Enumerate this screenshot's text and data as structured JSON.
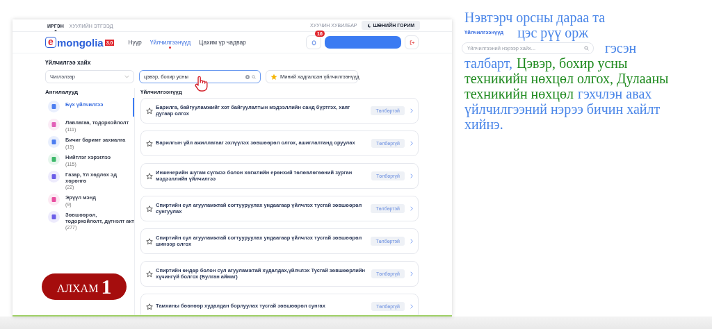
{
  "top_bar": {
    "tabs": [
      {
        "label": "ИРГЭН",
        "selected": true
      },
      {
        "label": "ХУУЛИЙН ЭТГЭЭД",
        "selected": false
      }
    ],
    "old_version_link": "ХУУЧИН ХУВИЛБАР",
    "night_mode_button": "ШӨНИЙН ГОРИМ"
  },
  "header": {
    "logo": {
      "letter": "e",
      "text": "mongolia",
      "version": "3.0"
    },
    "nav": [
      {
        "label": "Нүүр",
        "selected": false
      },
      {
        "label": "Үйлчилгээнүүд",
        "selected": true
      },
      {
        "label": "Цахим үр чадвар",
        "selected": false
      }
    ],
    "notifications": {
      "count": "16"
    }
  },
  "search": {
    "title": "Үйлчилгээ хайх",
    "category_select": {
      "value": "Чиглэлээр"
    },
    "search_field": {
      "value": "цэвэр, бохир усны"
    },
    "saved_button": "Миний хадгалсан үйлчилгээнүүд"
  },
  "categories": {
    "title": "Ангилалууд",
    "items": [
      {
        "name": "Бүх үйлчилгээ",
        "selected": true,
        "color": "#4c7df0"
      },
      {
        "name": "Лавлагаа, тодорхойлолт",
        "count": "(111)",
        "selected": false,
        "color": "#e25fb8"
      },
      {
        "name": "Бичиг баримт захиалга",
        "count": "(15)",
        "selected": false,
        "color": "#4c7df0"
      },
      {
        "name": "Нийтлэг хэрэглээ",
        "count": "(115)",
        "selected": false,
        "color": "#3db86a"
      },
      {
        "name": "Газар, Үл хөдлөх эд хөрөнгө",
        "count": "(22)",
        "selected": false,
        "color": "#6b5de8"
      },
      {
        "name": "Эрүүл мэнд",
        "count": "(9)",
        "selected": false,
        "color": "#e84fa0"
      },
      {
        "name": "Зөвшөөрөл, тодорхойлолт, дүгнэлт акт",
        "count": "(277)",
        "selected": false,
        "color": "#6b5de8"
      }
    ]
  },
  "services": {
    "title": "Үйлчилгээнүүд",
    "items": [
      {
        "title": "Барилга, байгууламжийг хот байгуулалтын мэдээллийн санд бүртгэх, хаяг дугаар олгох",
        "tag": "Төлбөртэй"
      },
      {
        "title": "Барилгын үйл ажиллагааг эхлүүлэх зөвшөөрөл олгох, ашиглалтанд оруулах",
        "tag": "Төлбөргүй"
      },
      {
        "title": "Инженерийн шугам сүлжээ болон хөгжлийн ерөнхий төлөвлөгөөний зурган мэдээллийн үйлчилгээ",
        "tag": "Төлбөргүй"
      },
      {
        "title": "Спиртийн сул агууламжтай согтууруулах ундаагаар үйлчлэх тусгай зөвшөөрөл сунгуулах",
        "tag": "Төлбөртэй"
      },
      {
        "title": "Спиртийн сул агууламжтай согтууруулах ундаагаар үйлчлэх тусгай зөвшөөрөл шинээр олгох",
        "tag": "Төлбөртэй"
      },
      {
        "title": "Спиртийн өндөр болон сул агууламжтай худалдах,үйлчлэх Тусгай зөвшөөрлийн хүчингүй болгох (Булган аймаг)",
        "tag": "Төлбөргүй"
      },
      {
        "title": "Тамхины бөөнөөр худалдан борлуулах тусгай зөвшөөрөл сунгах",
        "tag": "Төлбөргүй"
      }
    ]
  },
  "step": {
    "label": "АЛХАМ",
    "number": "1"
  },
  "instructions": [
    [
      {
        "kind": "text",
        "text": "Нэвтэрч орсны дараа та",
        "color": "#4a86e8"
      }
    ],
    [
      {
        "kind": "label",
        "text": "Үйлчилгээнүүд"
      },
      {
        "kind": "text",
        "text": "цэс рүү орж",
        "color": "#4a86e8"
      }
    ],
    [
      {
        "kind": "field",
        "placeholder": "Үйлчилгээний нэрээр хайх..."
      },
      {
        "kind": "text",
        "text": "гэсэн",
        "color": "#4a86e8"
      }
    ],
    [
      {
        "kind": "text",
        "text": "талбарт,",
        "color": "#4a86e8"
      },
      {
        "kind": "text",
        "text": "Цэвэр, бохир усны",
        "color": "#1f8a1f"
      }
    ],
    [
      {
        "kind": "text",
        "text": "техникийн нөхцөл олгох, Дулааны",
        "color": "#1f8a1f"
      }
    ],
    [
      {
        "kind": "text",
        "text": "техникийн нөхцөл",
        "color": "#1f8a1f"
      },
      {
        "kind": "text",
        "text": "гэхчлэн авах",
        "color": "#4a86e8"
      }
    ],
    [
      {
        "kind": "text",
        "text": "үйлчилгээний нэрээ бичин хайлт",
        "color": "#4a86e8"
      }
    ],
    [
      {
        "kind": "text",
        "text": "хийнэ.",
        "color": "#4a86e8"
      }
    ]
  ]
}
